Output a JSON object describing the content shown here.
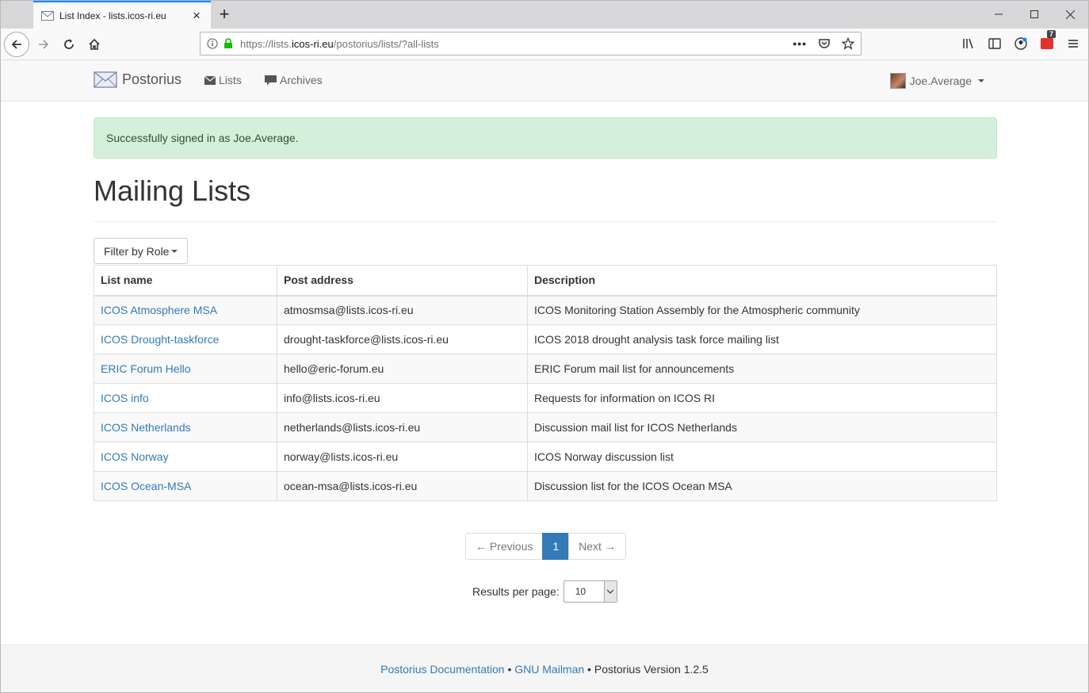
{
  "browser": {
    "tab_title": "List Index - lists.icos-ri.eu",
    "url_prefix": "https://lists.",
    "url_host": "icos-ri.eu",
    "url_path": "/postorius/lists/?all-lists",
    "notification_count": "7"
  },
  "site_nav": {
    "brand": "Postorius",
    "lists_label": "Lists",
    "archives_label": "Archives",
    "user_name": "Joe.Average"
  },
  "alert": "Successfully signed in as Joe.Average.",
  "page_title": "Mailing Lists",
  "filter_label": "Filter by Role",
  "table": {
    "headers": [
      "List name",
      "Post address",
      "Description"
    ],
    "rows": [
      {
        "name": "ICOS Atmosphere MSA",
        "address": "atmosmsa@lists.icos-ri.eu",
        "description": "ICOS Monitoring Station Assembly for the Atmospheric community"
      },
      {
        "name": "ICOS Drought-taskforce",
        "address": "drought-taskforce@lists.icos-ri.eu",
        "description": "ICOS 2018 drought analysis task force mailing list"
      },
      {
        "name": "ERIC Forum Hello",
        "address": "hello@eric-forum.eu",
        "description": "ERIC Forum mail list for announcements"
      },
      {
        "name": "ICOS info",
        "address": "info@lists.icos-ri.eu",
        "description": "Requests for information on ICOS RI"
      },
      {
        "name": "ICOS Netherlands",
        "address": "netherlands@lists.icos-ri.eu",
        "description": "Discussion mail list for ICOS Netherlands"
      },
      {
        "name": "ICOS Norway",
        "address": "norway@lists.icos-ri.eu",
        "description": "ICOS Norway discussion list"
      },
      {
        "name": "ICOS Ocean-MSA",
        "address": "ocean-msa@lists.icos-ri.eu",
        "description": "Discussion list for the ICOS Ocean MSA"
      }
    ]
  },
  "pagination": {
    "previous": "← Previous",
    "current": "1",
    "next": "Next →"
  },
  "per_page": {
    "label": "Results per page:",
    "value": "10"
  },
  "footer": {
    "docs_link": "Postorius Documentation",
    "sep1": " • ",
    "mailman_link": "GNU Mailman",
    "sep2": " • ",
    "version": "Postorius Version 1.2.5"
  },
  "colors": {
    "link": "#337ab7",
    "alert_bg": "#d4f0da",
    "active_page": "#337ab7",
    "tab_accent": "#0a84ff"
  }
}
